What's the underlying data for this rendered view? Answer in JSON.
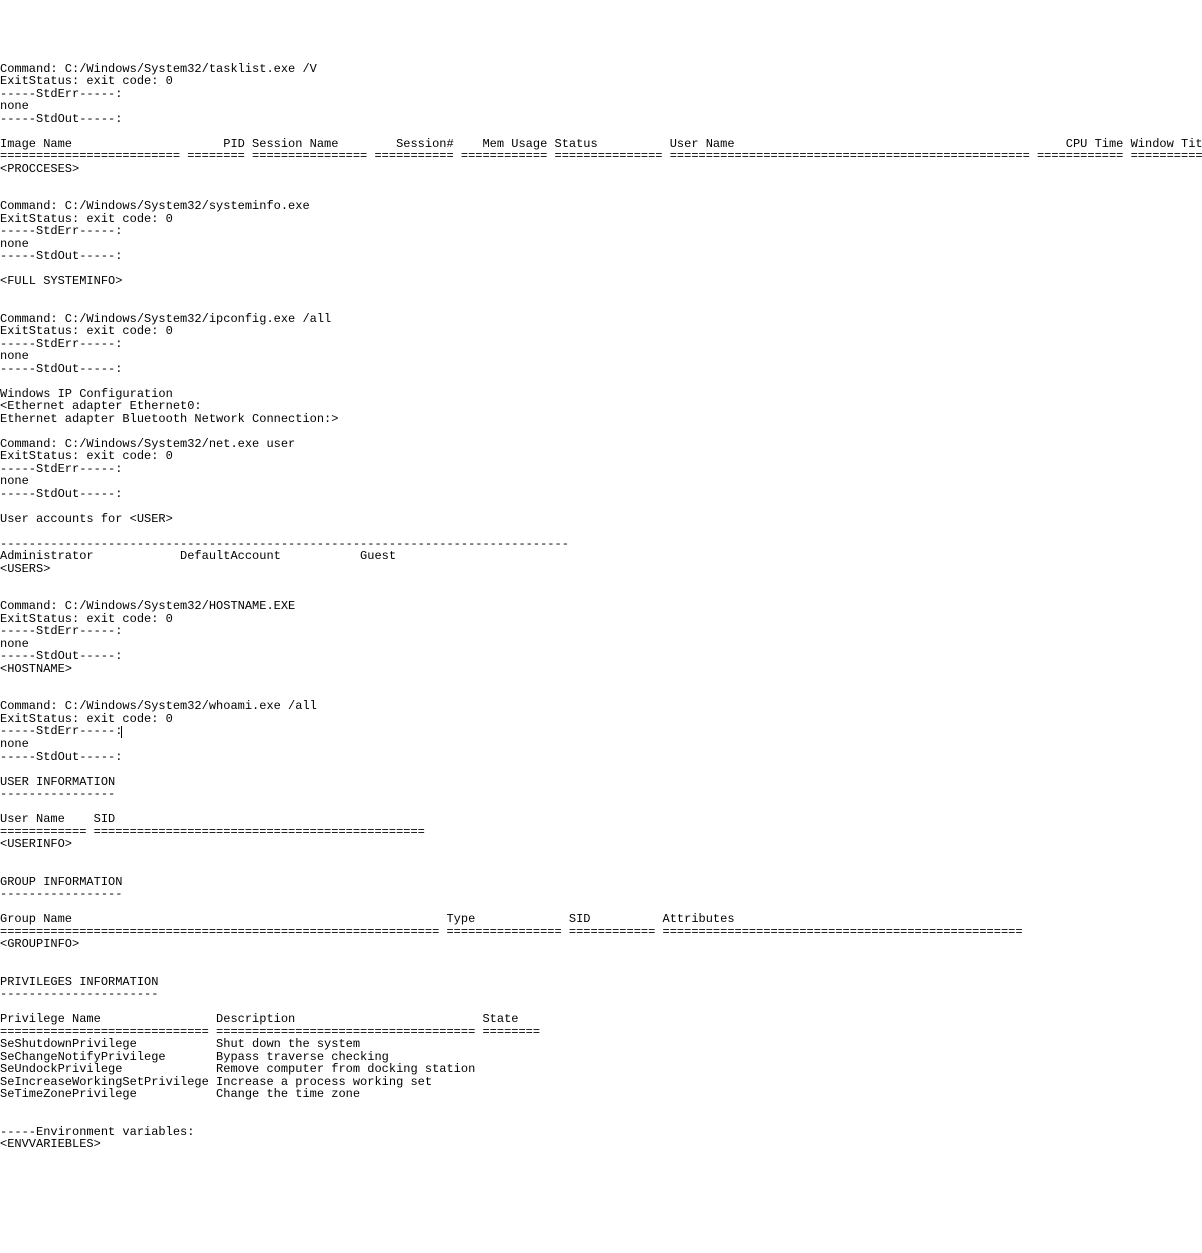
{
  "lines": [
    "Command: C:/Windows/System32/tasklist.exe /V",
    "ExitStatus: exit code: 0",
    "-----StdErr-----:",
    "none",
    "-----StdOut-----:",
    "",
    "Image Name                     PID Session Name        Session#    Mem Usage Status          User Name                                              CPU Time Window Title",
    "========================= ======== ================ =========== ============ =============== ================================================== ============ ================",
    "<PROCCESES>",
    "",
    "",
    "Command: C:/Windows/System32/systeminfo.exe",
    "ExitStatus: exit code: 0",
    "-----StdErr-----:",
    "none",
    "-----StdOut-----:",
    "",
    "<FULL SYSTEMINFO>",
    "",
    "",
    "Command: C:/Windows/System32/ipconfig.exe /all",
    "ExitStatus: exit code: 0",
    "-----StdErr-----:",
    "none",
    "-----StdOut-----:",
    "",
    "Windows IP Configuration",
    "<Ethernet adapter Ethernet0:",
    "Ethernet adapter Bluetooth Network Connection:>",
    "",
    "Command: C:/Windows/System32/net.exe user",
    "ExitStatus: exit code: 0",
    "-----StdErr-----:",
    "none",
    "-----StdOut-----:",
    "",
    "User accounts for <USER>",
    "",
    "-------------------------------------------------------------------------------",
    "Administrator            DefaultAccount           Guest",
    "<USERS>",
    "",
    "",
    "Command: C:/Windows/System32/HOSTNAME.EXE",
    "ExitStatus: exit code: 0",
    "-----StdErr-----:",
    "none",
    "-----StdOut-----:",
    "<HOSTNAME>",
    "",
    "",
    "Command: C:/Windows/System32/whoami.exe /all",
    "ExitStatus: exit code: 0",
    "-----StdErr-----:|",
    "none",
    "-----StdOut-----:",
    "",
    "USER INFORMATION",
    "----------------",
    "",
    "User Name    SID",
    "============ ==============================================",
    "<USERINFO>",
    "",
    "",
    "GROUP INFORMATION",
    "-----------------",
    "",
    "Group Name                                                    Type             SID          Attributes",
    "============================================================= ================ ============ ==================================================",
    "<GROUPINFO>",
    "",
    "",
    "PRIVILEGES INFORMATION",
    "----------------------",
    "",
    "Privilege Name                Description                          State",
    "============================= ==================================== ========",
    "SeShutdownPrivilege           Shut down the system",
    "SeChangeNotifyPrivilege       Bypass traverse checking",
    "SeUndockPrivilege             Remove computer from docking station",
    "SeIncreaseWorkingSetPrivilege Increase a process working set",
    "SeTimeZonePrivilege           Change the time zone",
    "",
    "",
    "-----Environment variables:",
    "<ENVVARIEBLES>"
  ]
}
